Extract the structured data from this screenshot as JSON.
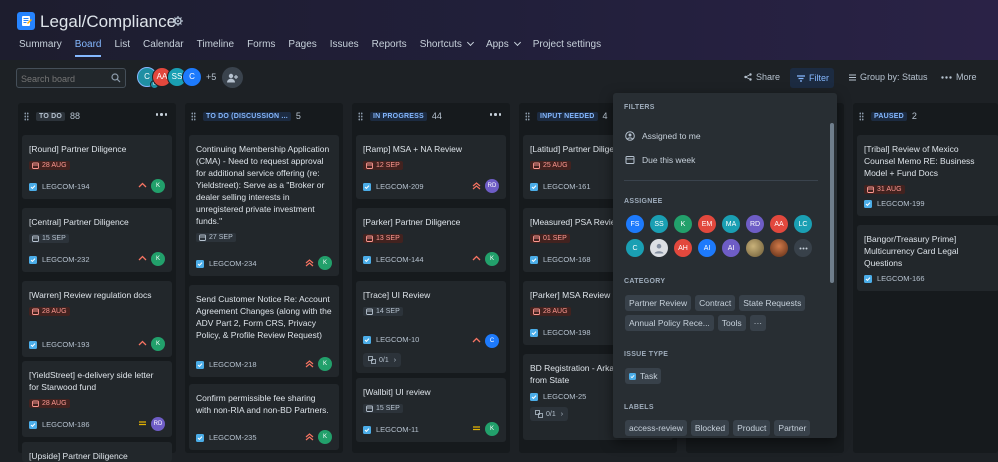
{
  "project": {
    "title": "Legal/Compliance"
  },
  "nav": {
    "tabs": [
      "Summary",
      "Board",
      "List",
      "Calendar",
      "Timeline",
      "Forms",
      "Pages",
      "Issues",
      "Reports"
    ],
    "dropdowns": [
      "Shortcuts",
      "Apps"
    ],
    "settings": "Project settings",
    "active_tab": "Board"
  },
  "search": {
    "placeholder": "Search board"
  },
  "avatars": [
    {
      "initials": "C",
      "color": "#1f8fa3",
      "badge": "C"
    },
    {
      "initials": "AA",
      "color": "#e2483d"
    },
    {
      "initials": "SS",
      "color": "#1a9fb3"
    },
    {
      "initials": "C",
      "color": "#1d7afc"
    }
  ],
  "avatars_more": "+5",
  "toolbar": {
    "share": "Share",
    "filter": "Filter",
    "group_by": "Group by: Status",
    "more": "More"
  },
  "columns": [
    {
      "name": "TO DO",
      "count": "88",
      "badge_bg": "#2c333a",
      "badge_fg": "#b6c2cf"
    },
    {
      "name": "TO DO (DISCUSSION ...",
      "count": "5",
      "badge_bg": "#1c2b41",
      "badge_fg": "#85b8ff"
    },
    {
      "name": "IN PROGRESS",
      "count": "44",
      "badge_bg": "#1c2b41",
      "badge_fg": "#85b8ff"
    },
    {
      "name": "INPUT NEEDED",
      "count": "4",
      "badge_bg": "#1c2b41",
      "badge_fg": "#85b8ff"
    },
    {
      "name": "PAUSED",
      "count": "2",
      "badge_bg": "#1c2b41",
      "badge_fg": "#85b8ff"
    }
  ],
  "cards": {
    "c0": [
      {
        "title": "[Round] Partner Diligence",
        "date": "28 AUG",
        "date_style": "red",
        "key": "LEGCOM-194",
        "priority": "high",
        "assignee": "K",
        "assignee_color": "#22a06b"
      },
      {
        "title": "[Central] Partner Diligence",
        "date": "15 SEP",
        "date_style": "grey",
        "key": "LEGCOM-232",
        "priority": "high",
        "assignee": "K",
        "assignee_color": "#22a06b"
      },
      {
        "title": "[Warren] Review regulation docs",
        "date": "28 AUG",
        "date_style": "red",
        "key": "LEGCOM-193",
        "priority": "high",
        "assignee": "K",
        "assignee_color": "#22a06b"
      },
      {
        "title": "[YieldStreet] e-delivery side letter for Starwood fund",
        "date": "28 AUG",
        "date_style": "red",
        "key": "LEGCOM-186",
        "priority": "medium",
        "assignee": "RD",
        "assignee_color": "#6e5dc6"
      },
      {
        "title": "[Upside] Partner Diligence"
      }
    ],
    "c1": [
      {
        "title": "Continuing Membership Application (CMA) - Need to request approval for additional service offering (re: Yieldstreet): Serve as a \"Broker or dealer selling interests in unregistered private investment funds.\"",
        "date": "27 SEP",
        "date_style": "grey",
        "key": "LEGCOM-234",
        "priority": "highest",
        "assignee": "K",
        "assignee_color": "#22a06b"
      },
      {
        "title": "Send Customer Notice Re: Account Agreement Changes (along with the ADV Part 2, Form CRS, Privacy Policy, & Profile Review Request)",
        "key": "LEGCOM-218",
        "priority": "highest",
        "assignee": "K",
        "assignee_color": "#22a06b"
      },
      {
        "title": "Confirm permissible fee sharing with non-RIA and non-BD Partners.",
        "key": "LEGCOM-235",
        "priority": "highest",
        "assignee": "K",
        "assignee_color": "#22a06b"
      }
    ],
    "c2": [
      {
        "title": "[Ramp] MSA + NA Review",
        "date": "12 SEP",
        "date_style": "red",
        "key": "LEGCOM-209",
        "priority": "highest",
        "assignee": "RD",
        "assignee_color": "#6e5dc6"
      },
      {
        "title": "[Parker] Partner Diligence",
        "date": "13 SEP",
        "date_style": "red",
        "key": "LEGCOM-144",
        "priority": "high",
        "assignee": "K",
        "assignee_color": "#22a06b"
      },
      {
        "title": "[Trace] UI Review",
        "date": "14 SEP",
        "date_style": "grey",
        "key": "LEGCOM-10",
        "priority": "high",
        "assignee": "C",
        "assignee_color": "#1d7afc",
        "subtasks": "0/1"
      },
      {
        "title": "[Wallbit] UI review",
        "date": "15 SEP",
        "date_style": "grey",
        "key": "LEGCOM-11",
        "priority": "medium",
        "assignee": "K",
        "assignee_color": "#22a06b"
      }
    ],
    "c3": [
      {
        "title": "[Latitud] Partner Dilige",
        "date": "25 AUG",
        "date_style": "red",
        "key": "LEGCOM-161"
      },
      {
        "title": "[Measured] PSA Revie",
        "date": "01 SEP",
        "date_style": "red",
        "key": "LEGCOM-168"
      },
      {
        "title": "[Parker] MSA Review",
        "date": "28 AUG",
        "date_style": "red",
        "key": "LEGCOM-198"
      },
      {
        "title": "BD Registration - Arka Requests from State",
        "key": "LEGCOM-25",
        "subtasks": "0/1"
      }
    ],
    "c4": [
      {
        "title": "[Tribal] Review of Mexico Counsel Memo RE: Business Model + Fund Docs",
        "date": "31 AUG",
        "date_style": "red",
        "key": "LEGCOM-199"
      },
      {
        "title": "[Bangor/Treasury Prime] Multicurrency Card Legal Questions",
        "key": "LEGCOM-166"
      }
    ]
  },
  "filters": {
    "heading": "FILTERS",
    "quick": [
      "Assigned to me",
      "Due this week"
    ],
    "assignee_heading": "ASSIGNEE",
    "assignees_row1": [
      {
        "t": "FS",
        "c": "#1d7afc"
      },
      {
        "t": "SS",
        "c": "#1a9fb3"
      },
      {
        "t": "K",
        "c": "#22a06b"
      },
      {
        "t": "EM",
        "c": "#e2483d"
      },
      {
        "t": "MA",
        "c": "#1a9fb3"
      },
      {
        "t": "RD",
        "c": "#6e5dc6"
      },
      {
        "t": "AA",
        "c": "#e2483d"
      },
      {
        "t": "LC",
        "c": "#1a9fb3"
      }
    ],
    "assignees_row2": [
      {
        "t": "C",
        "c": "#1a9fb3"
      },
      {
        "t": "",
        "c": "#dcdfe4"
      },
      {
        "t": "AH",
        "c": "#e2483d"
      },
      {
        "t": "AI",
        "c": "#1d7afc"
      },
      {
        "t": "AI",
        "c": "#6e5dc6"
      },
      {
        "t": "",
        "c": "#a38b5c"
      },
      {
        "t": "",
        "c": "#8a4b2b"
      }
    ],
    "category_heading": "CATEGORY",
    "categories_row1": [
      "Partner Review",
      "Contract",
      "State Requests"
    ],
    "categories_row2": [
      "Annual Policy Rece...",
      "Tools"
    ],
    "issue_type_heading": "ISSUE TYPE",
    "issue_type": "Task",
    "labels_heading": "LABELS",
    "labels": [
      "access-review",
      "Blocked",
      "Product",
      "Partner"
    ]
  }
}
